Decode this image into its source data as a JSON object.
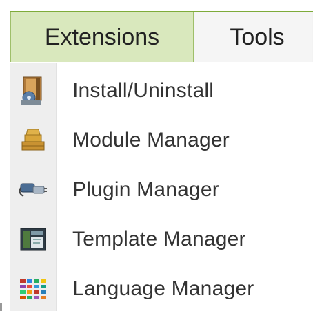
{
  "menubar": {
    "tabs": [
      {
        "label": "Extensions",
        "active": true
      },
      {
        "label": "Tools",
        "active": false
      }
    ]
  },
  "dropdown": {
    "items": [
      {
        "label": "Install/Uninstall",
        "icon": "install-icon"
      },
      {
        "label": "Module Manager",
        "icon": "module-icon"
      },
      {
        "label": "Plugin Manager",
        "icon": "plugin-icon"
      },
      {
        "label": "Template Manager",
        "icon": "template-icon"
      },
      {
        "label": "Language Manager",
        "icon": "language-icon"
      }
    ]
  },
  "colors": {
    "accent_green": "#7eab3a",
    "active_tab_bg": "#d9e8bd",
    "gutter_bg": "#eeeeee"
  }
}
